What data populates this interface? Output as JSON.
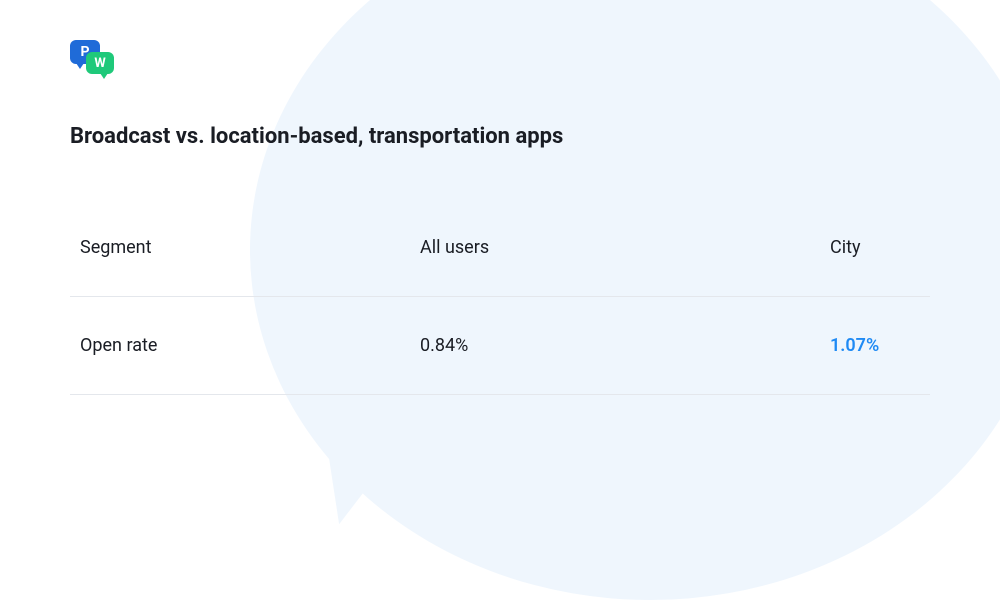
{
  "logo": {
    "letter_p": "P",
    "letter_w": "W"
  },
  "title": "Broadcast vs. location-based, transportation apps",
  "table": {
    "header": {
      "label": "Segment",
      "col1": "All users",
      "col2": "City"
    },
    "row1": {
      "label": "Open rate",
      "col1": "0.84%",
      "col2": "1.07%"
    }
  },
  "colors": {
    "highlight": "#1f8af4",
    "text": "#1a1d24",
    "divider": "#e4e7ec",
    "bg_bubble": "#eff6fd",
    "logo_blue": "#1f6bd8",
    "logo_green": "#1fc97a"
  },
  "chart_data": {
    "type": "table",
    "title": "Broadcast vs. location-based, transportation apps",
    "columns": [
      "Segment",
      "All users",
      "City"
    ],
    "rows": [
      {
        "metric": "Open rate",
        "all_users": 0.84,
        "city": 1.07,
        "unit": "%"
      }
    ],
    "highlight_column": "City"
  }
}
